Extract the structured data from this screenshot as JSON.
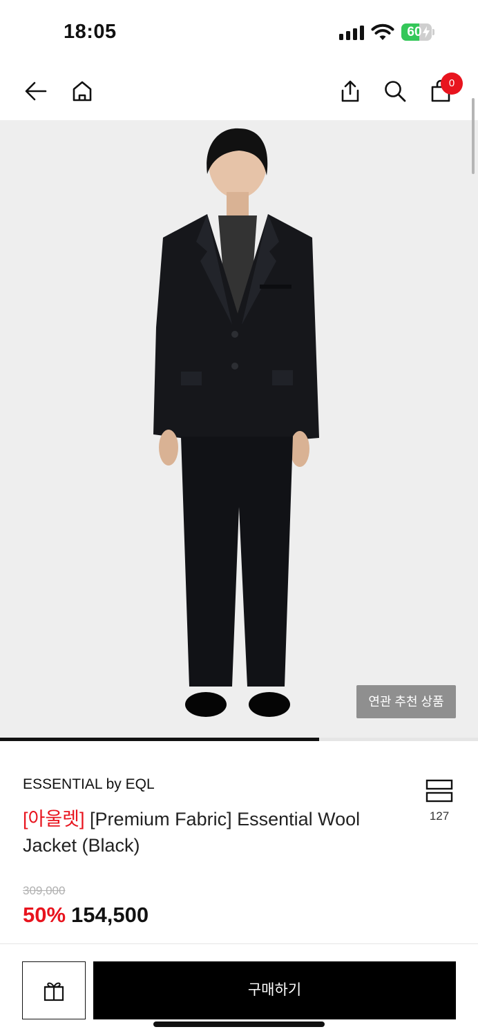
{
  "status_bar": {
    "time": "18:05",
    "battery_level": "60",
    "battery_fraction": 0.6,
    "battery_charging": true
  },
  "nav": {
    "icons": [
      "back-arrow-icon",
      "home-icon",
      "share-icon",
      "search-icon",
      "shopping-bag-icon"
    ],
    "cart_count": "0"
  },
  "hero": {
    "related_button_label": "연관 추천 상품",
    "gallery_progress_fraction": 0.667
  },
  "product": {
    "brand": "ESSENTIAL by EQL",
    "title_tag": "[아울렛]",
    "title": "[Premium Fabric] Essential Wool Jacket (Black)",
    "wish_count": "127",
    "original_price": "309,000",
    "discount_rate": "50%",
    "final_price": "154,500"
  },
  "bottom_bar": {
    "gift_icon": "gift-icon",
    "buy_label": "구매하기"
  },
  "colors": {
    "accent_red": "#e8141e",
    "buy_button": "#000000",
    "hero_background": "#eeeeee",
    "related_button": "#8f8f8f",
    "battery_green": "#34c759"
  }
}
